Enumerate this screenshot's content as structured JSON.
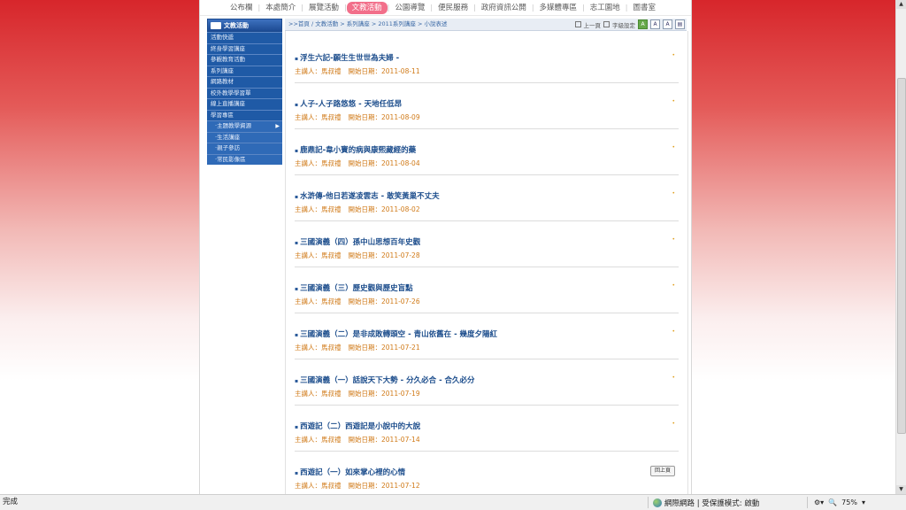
{
  "topnav": {
    "items": [
      {
        "label": "公布欄",
        "active": false
      },
      {
        "label": "本處簡介",
        "active": false
      },
      {
        "label": "展覽活動",
        "active": false
      },
      {
        "label": "文教活動",
        "active": true
      },
      {
        "label": "公園導覽",
        "active": false
      },
      {
        "label": "便民服務",
        "active": false
      },
      {
        "label": "政府資訊公開",
        "active": false
      },
      {
        "label": "多媒體專區",
        "active": false
      },
      {
        "label": "志工園地",
        "active": false
      },
      {
        "label": "圖書室",
        "active": false
      }
    ]
  },
  "sidebar": {
    "header": "文教活動",
    "items": [
      {
        "label": "活動快遞",
        "sub": false
      },
      {
        "label": "終身學習講座",
        "sub": false
      },
      {
        "label": "參觀教育活動",
        "sub": false
      },
      {
        "label": "系列講座",
        "sub": false
      },
      {
        "label": "網路教材",
        "sub": false
      },
      {
        "label": "校外教學學習單",
        "sub": false
      },
      {
        "label": "線上直播講座",
        "sub": false
      },
      {
        "label": "學習專區",
        "sub": false
      },
      {
        "label": "‧主題教學資源",
        "sub": true,
        "arrow": "▶"
      },
      {
        "label": "‧生活講座",
        "sub": true
      },
      {
        "label": "‧親子參訪",
        "sub": true
      },
      {
        "label": "‧常民影像區",
        "sub": true
      }
    ]
  },
  "breadcrumb": ">>首頁 / 文教活動 > 系列講座 > 2011系列講座 > 小說表述",
  "tools": {
    "prev_label": "上一頁",
    "font_label": "字級設定",
    "font_buttons": [
      "A",
      "A",
      "A"
    ]
  },
  "articles": [
    {
      "title": "浮生六記-願生生世世為夫婦 -",
      "speaker_label": "主講人：馬叔禮",
      "date_label": "開始日期：2011-08-11"
    },
    {
      "title": "人子-人子路悠悠 - 天地任低昂",
      "speaker_label": "主講人：馬叔禮",
      "date_label": "開始日期：2011-08-09"
    },
    {
      "title": "鹿鼎記-韋小寶的病與康熙藏經的藥",
      "speaker_label": "主講人：馬叔禮",
      "date_label": "開始日期：2011-08-04"
    },
    {
      "title": "水滸傳-他日若遂凌雲志 - 敢笑黃巢不丈夫",
      "speaker_label": "主講人：馬叔禮",
      "date_label": "開始日期：2011-08-02"
    },
    {
      "title": "三國演義（四）孫中山思想百年史觀",
      "speaker_label": "主講人：馬叔禮",
      "date_label": "開始日期：2011-07-28"
    },
    {
      "title": "三國演義（三）歷史觀與歷史盲點",
      "speaker_label": "主講人：馬叔禮",
      "date_label": "開始日期：2011-07-26"
    },
    {
      "title": "三國演義（二）是非成敗轉頭空 - 青山依舊在 - 幾度夕陽紅",
      "speaker_label": "主講人：馬叔禮",
      "date_label": "開始日期：2011-07-21"
    },
    {
      "title": "三國演義（一）話說天下大勢 - 分久必合 - 合久必分",
      "speaker_label": "主講人：馬叔禮",
      "date_label": "開始日期：2011-07-19"
    },
    {
      "title": "西遊記（二）西遊記是小說中的大說",
      "speaker_label": "主講人：馬叔禮",
      "date_label": "開始日期：2011-07-14"
    },
    {
      "title": "西遊記（一）如來掌心裡的心情",
      "speaker_label": "主講人：馬叔禮",
      "date_label": "開始日期：2011-07-12"
    }
  ],
  "back_button": "回上頁",
  "statusbar": {
    "status": "完成",
    "zone": "網際網路 | 受保護模式: 啟動",
    "zoom": "75%"
  }
}
